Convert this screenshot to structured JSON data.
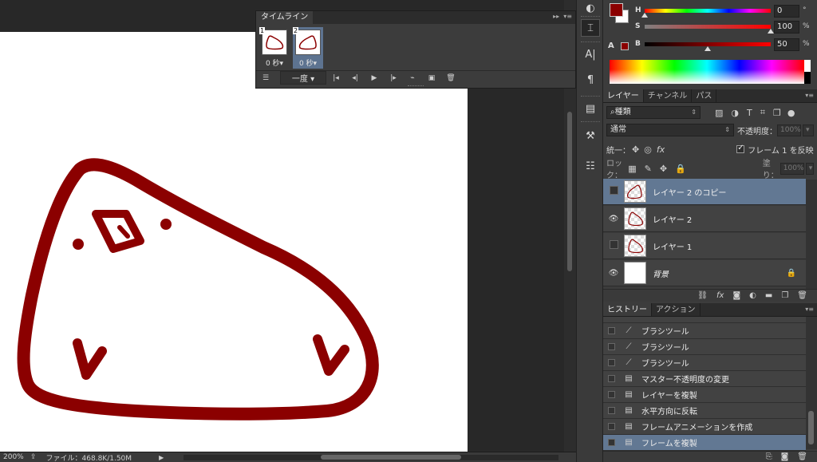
{
  "status": {
    "zoom": "200%",
    "file_info": "ファイル：468.8K/1.50M"
  },
  "timeline": {
    "title": "タイムライン",
    "frames": [
      {
        "num": "1",
        "duration": "0 秒▾"
      },
      {
        "num": "2",
        "duration": "0 秒▾"
      }
    ],
    "loop": "一度"
  },
  "color": {
    "foreground": "#8b0000",
    "h_label": "H",
    "h_value": "0",
    "h_unit": "°",
    "s_label": "S",
    "s_value": "100",
    "s_unit": "%",
    "b_label": "B",
    "b_value": "50",
    "b_unit": "%",
    "gamut_warning": "A"
  },
  "layers_panel": {
    "tabs": [
      "レイヤー",
      "チャンネル",
      "パス"
    ],
    "kind_filter": "⌕種類",
    "blend_mode": "通常",
    "opacity_label": "不透明度：",
    "opacity_value": "100%",
    "unify_label": "統一：",
    "propagate_label": "フレーム 1 を反映",
    "lock_label": "ロック：",
    "fill_label": "塗り：",
    "fill_value": "100%",
    "layers": [
      {
        "name": "レイヤー 2 のコピー",
        "visible": false,
        "selected": true
      },
      {
        "name": "レイヤー 2",
        "visible": true,
        "selected": false
      },
      {
        "name": "レイヤー 1",
        "visible": false,
        "selected": false
      },
      {
        "name": "背景",
        "visible": true,
        "selected": false,
        "locked": true
      }
    ]
  },
  "history_panel": {
    "tabs": [
      "ヒストリー",
      "アクション"
    ],
    "items": [
      {
        "label": "ブラシツール",
        "icon": "brush-icon"
      },
      {
        "label": "ブラシツール",
        "icon": "brush-icon"
      },
      {
        "label": "ブラシツール",
        "icon": "brush-icon"
      },
      {
        "label": "マスター不透明度の変更",
        "icon": "document-icon"
      },
      {
        "label": "レイヤーを複製",
        "icon": "document-icon"
      },
      {
        "label": "水平方向に反転",
        "icon": "document-icon"
      },
      {
        "label": "フレームアニメーションを作成",
        "icon": "document-icon"
      },
      {
        "label": "フレームを複製",
        "icon": "document-icon",
        "selected": true
      }
    ]
  }
}
